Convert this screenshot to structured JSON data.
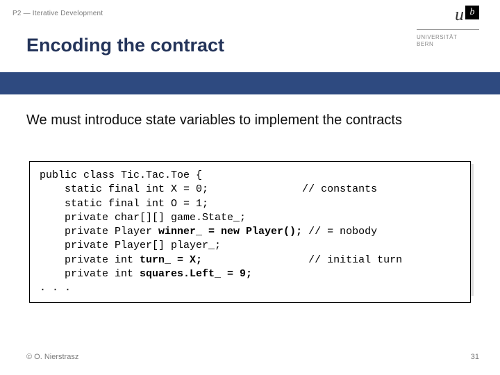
{
  "header": {
    "breadcrumb": "P2 — Iterative Development"
  },
  "logo": {
    "u": "u",
    "b": "b",
    "uni1": "UNIVERSITÄT",
    "uni2": "BERN"
  },
  "title": "Encoding the contract",
  "body": "We must introduce state variables to implement the contracts",
  "code": {
    "l1": "public class Tic.Tac.Toe {",
    "l2": "    static final int X = 0;               // constants",
    "l3": "    static final int O = 1;",
    "l4": "    private char[][] game.State_;",
    "l5a": "    private Player ",
    "l5b": "winner_ = new Player();",
    "l5c": " // = nobody",
    "l6": "    private Player[] player_;",
    "l7a": "    private int ",
    "l7b": "turn_ = X;",
    "l7c": "                 // initial turn",
    "l8a": "    private int ",
    "l8b": "squares.Left_ = 9;",
    "l9": ". . ."
  },
  "footer": {
    "left": "© O. Nierstrasz",
    "right": "31"
  }
}
